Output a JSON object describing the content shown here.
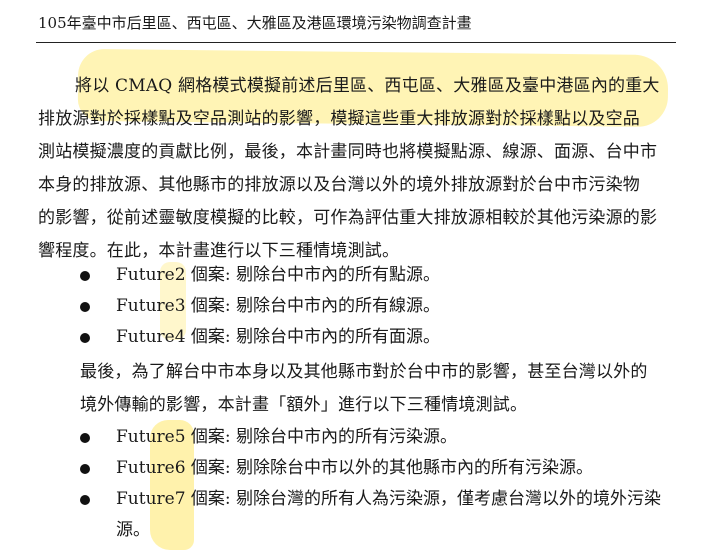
{
  "header": {
    "title": "105年臺中市后里區、西屯區、大雅區及港區環境污染物調查計畫"
  },
  "paragraph1": {
    "lines": [
      "將以 CMAQ 網格模式模擬前述后里區、西屯區、大雅區及臺中港區內的重大",
      "排放源對於採樣點及空品測站的影響，模擬這些重大排放源對於採樣點以及空品",
      "測站模擬濃度的貢獻比例，最後，本計畫同時也將模擬點源、線源、面源、台中市",
      "本身的排放源、其他縣市的排放源以及台灣以外的境外排放源對於台中市污染物",
      "的影響，從前述靈敏度模擬的比較，可作為評估重大排放源相較於其他污染源的影",
      "響程度。在此，本計畫進行以下三種情境測試。"
    ]
  },
  "list1": [
    "Future2 個案:  剔除台中市內的所有點源。",
    "Future3 個案:  剔除台中市內的所有線源。",
    "Future4 個案:  剔除台中市內的所有面源。"
  ],
  "paragraph2": {
    "lines": [
      "最後，為了解台中市本身以及其他縣市對於台中市的影響，甚至台灣以外的",
      "境外傳輸的影響，本計畫「額外」進行以下三種情境測試。"
    ]
  },
  "list2": [
    "Future5 個案:  剔除台中市內的所有污染源。",
    "Future6 個案:  剔除除台中市以外的其他縣市內的所有污染源。",
    "Future7 個案:  剔除台灣的所有人為污染源，僅考慮台灣以外的境外污染"
  ],
  "list2_last_continuation": "源。",
  "colors": {
    "highlight": "#ffe65a",
    "text": "#1a1a1a"
  }
}
